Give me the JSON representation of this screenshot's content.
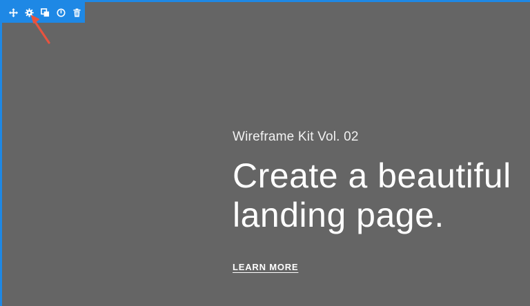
{
  "toolbar": {
    "buttons": [
      {
        "icon": "move-icon"
      },
      {
        "icon": "gear-icon"
      },
      {
        "icon": "duplicate-icon"
      },
      {
        "icon": "power-icon"
      },
      {
        "icon": "trash-icon"
      }
    ],
    "accent_color": "#1e88e5"
  },
  "annotation": {
    "icon": "red-arrow-icon",
    "color": "#e8533f"
  },
  "hero": {
    "eyebrow": "Wireframe Kit Vol. 02",
    "headline_line1": "Create a beautiful",
    "headline_line2": "landing page.",
    "cta_label": "LEARN MORE"
  },
  "background_color": "#656565"
}
